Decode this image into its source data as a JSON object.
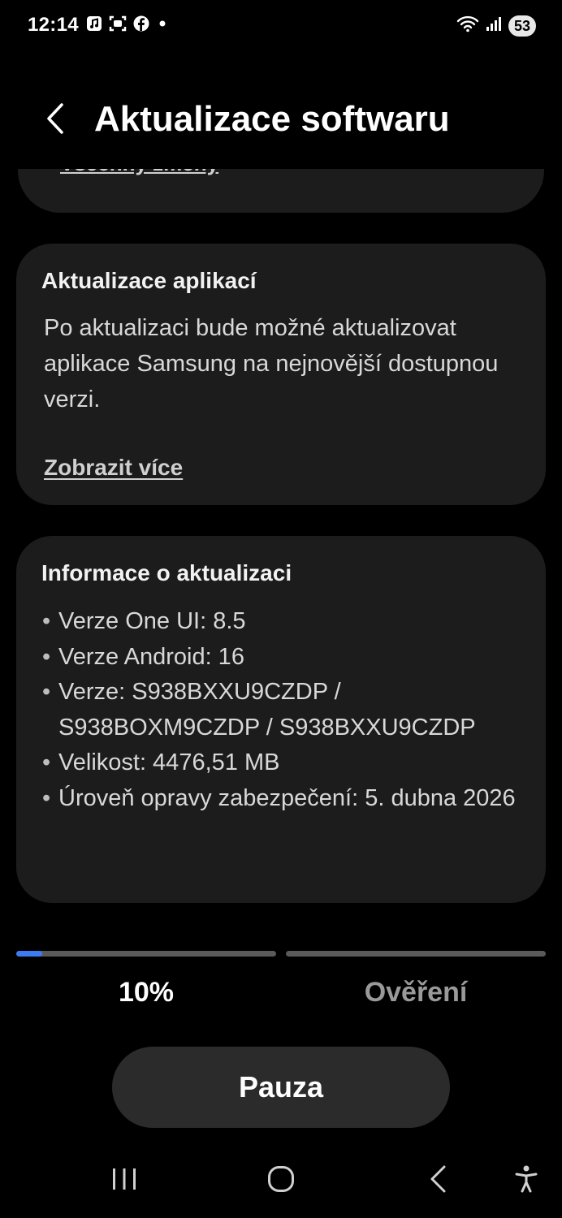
{
  "status_bar": {
    "time": "12:14",
    "battery": "53",
    "left_icons": [
      "music-app-icon",
      "screen-capture-icon",
      "facebook-icon",
      "dot-icon"
    ],
    "right_icons": [
      "wifi-icon",
      "signal-icon"
    ]
  },
  "header": {
    "title": "Aktualizace softwaru"
  },
  "partial_card": {
    "link": "Všechny změny"
  },
  "app_updates": {
    "title": "Aktualizace aplikací",
    "body": "Po aktualizaci bude možné aktualizovat aplikace Samsung na nejnovější dostupnou verzi.",
    "link": "Zobrazit více"
  },
  "update_info": {
    "title": "Informace o aktualizaci",
    "items": [
      "Verze One UI: 8.5",
      "Verze Android: 16",
      "Verze: S938BXXU9CZDP / S938BOXM9CZDP / S938BXXU9CZDP",
      "Velikost: 4476,51 MB",
      "Úroveň opravy zabezpečení: 5. dubna 2026"
    ]
  },
  "progress": {
    "download_fraction": 0.1,
    "step1_label": "10%",
    "step2_label": "Ověření"
  },
  "actions": {
    "pause_label": "Pauza"
  },
  "nav": {
    "items": [
      "recents-icon",
      "home-icon",
      "back-icon",
      "accessibility-icon"
    ]
  },
  "colors": {
    "background": "#000000",
    "card": "#1c1c1c",
    "accent": "#3d7bf3",
    "button": "#2b2b2b"
  }
}
